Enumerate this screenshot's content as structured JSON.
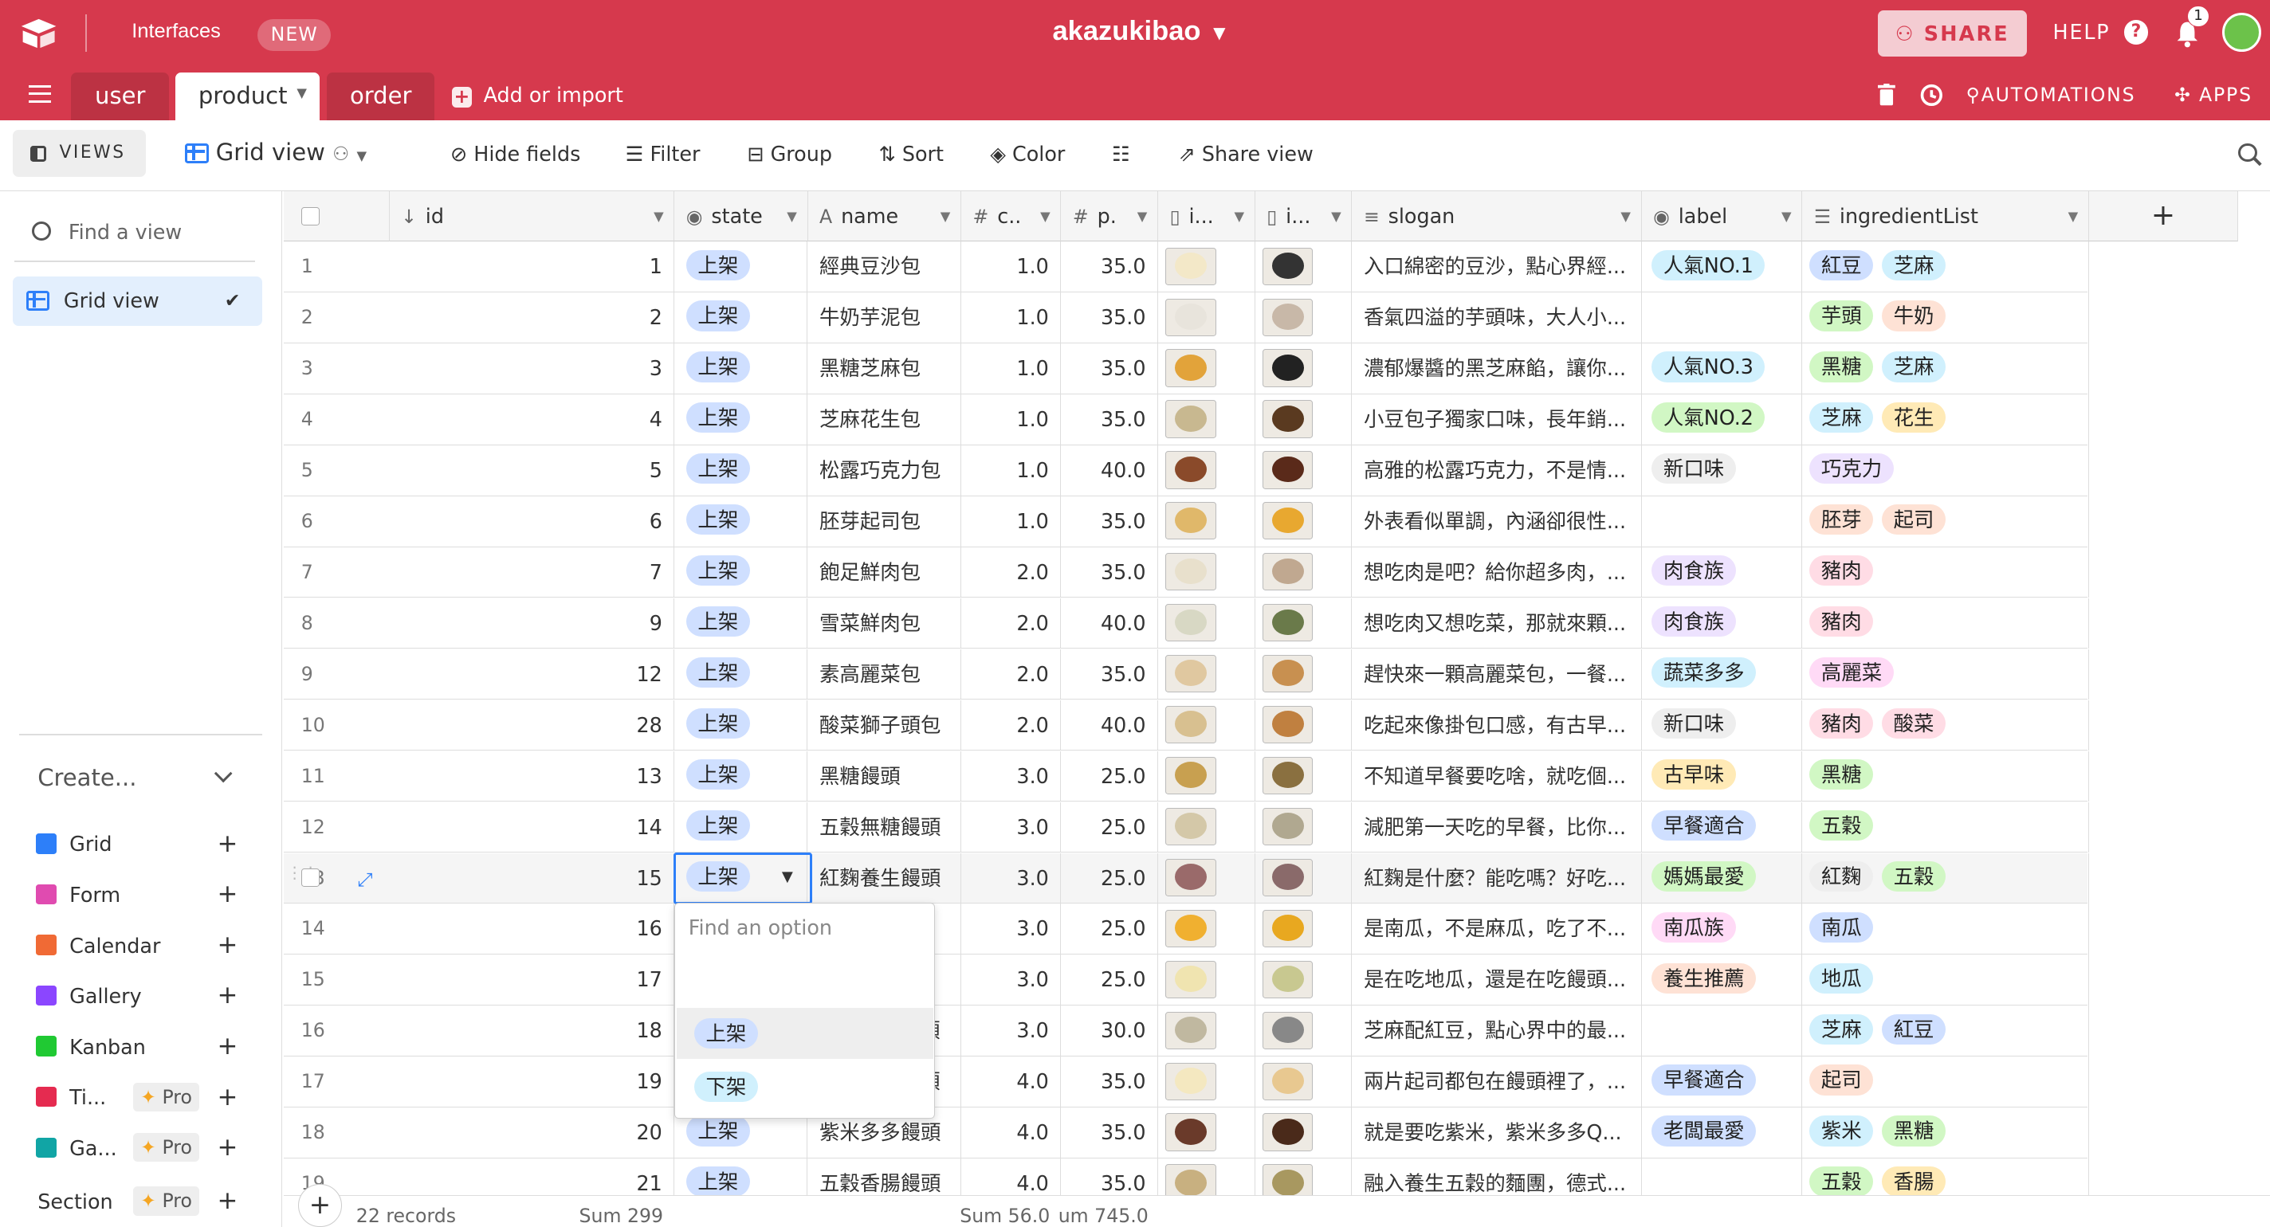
{
  "topbar": {
    "interfaces": "Interfaces",
    "new_badge": "NEW",
    "base_name": "akazukibao",
    "share": "SHARE",
    "help": "HELP",
    "notifications": "1",
    "accent": "#d6394d"
  },
  "tabs": [
    {
      "label": "user"
    },
    {
      "label": "product",
      "active": true
    },
    {
      "label": "order"
    }
  ],
  "add_import": "Add or import",
  "toolbar_right": {
    "automations": "AUTOMATIONS",
    "apps": "APPS"
  },
  "viewbar": {
    "views": "VIEWS",
    "view_name": "Grid view",
    "hide_fields": "Hide fields",
    "filter": "Filter",
    "group": "Group",
    "sort": "Sort",
    "color": "Color",
    "share_view": "Share view"
  },
  "sidebar": {
    "find_view": "Find a view",
    "current_view": "Grid view",
    "create": "Create...",
    "items": [
      {
        "label": "Grid",
        "color": "#2d7ff9"
      },
      {
        "label": "Form",
        "color": "#e04bb0"
      },
      {
        "label": "Calendar",
        "color": "#f06a35"
      },
      {
        "label": "Gallery",
        "color": "#8b46ff"
      },
      {
        "label": "Kanban",
        "color": "#20c933"
      },
      {
        "label": "Ti...",
        "color": "#e52b50",
        "pro": "Pro"
      },
      {
        "label": "Ga...",
        "color": "#11a5a5",
        "pro": "Pro"
      },
      {
        "label": "Section",
        "pro": "Pro"
      }
    ]
  },
  "columns": [
    "id",
    "state",
    "name",
    "c..",
    "p.",
    "i...",
    "i...",
    "slogan",
    "label",
    "ingredientList"
  ],
  "rows": [
    {
      "n": "1",
      "id": "1",
      "state": "上架",
      "name": "經典豆沙包",
      "c": "1.0",
      "p": "35.0",
      "slogan": "入口綿密的豆沙，點心界經...",
      "label": "人氣NO.1",
      "ing": [
        "紅豆",
        "芝麻"
      ]
    },
    {
      "n": "2",
      "id": "2",
      "state": "上架",
      "name": "牛奶芋泥包",
      "c": "1.0",
      "p": "35.0",
      "slogan": "香氣四溢的芋頭味，大人小...",
      "label": "",
      "ing": [
        "芋頭",
        "牛奶"
      ]
    },
    {
      "n": "3",
      "id": "3",
      "state": "上架",
      "name": "黑糖芝麻包",
      "c": "1.0",
      "p": "35.0",
      "slogan": "濃郁爆醬的黑芝麻餡，讓你...",
      "label": "人氣NO.3",
      "ing": [
        "黑糖",
        "芝麻"
      ]
    },
    {
      "n": "4",
      "id": "4",
      "state": "上架",
      "name": "芝麻花生包",
      "c": "1.0",
      "p": "35.0",
      "slogan": "小豆包子獨家口味，長年銷...",
      "label": "人氣NO.2",
      "ing": [
        "芝麻",
        "花生"
      ]
    },
    {
      "n": "5",
      "id": "5",
      "state": "上架",
      "name": "松露巧克力包",
      "c": "1.0",
      "p": "40.0",
      "slogan": "高雅的松露巧克力，不是情...",
      "label": "新口味",
      "ing": [
        "巧克力"
      ]
    },
    {
      "n": "6",
      "id": "6",
      "state": "上架",
      "name": "胚芽起司包",
      "c": "1.0",
      "p": "35.0",
      "slogan": "外表看似單調，內涵卻很性...",
      "label": "",
      "ing": [
        "胚芽",
        "起司"
      ]
    },
    {
      "n": "7",
      "id": "7",
      "state": "上架",
      "name": "飽足鮮肉包",
      "c": "2.0",
      "p": "35.0",
      "slogan": "想吃肉是吧？給你超多肉，...",
      "label": "肉食族",
      "ing": [
        "豬肉"
      ]
    },
    {
      "n": "8",
      "id": "9",
      "state": "上架",
      "name": "雪菜鮮肉包",
      "c": "2.0",
      "p": "40.0",
      "slogan": "想吃肉又想吃菜，那就來顆...",
      "label": "肉食族",
      "ing": [
        "豬肉"
      ]
    },
    {
      "n": "9",
      "id": "12",
      "state": "上架",
      "name": "素高麗菜包",
      "c": "2.0",
      "p": "35.0",
      "slogan": "趕快來一顆高麗菜包，一餐...",
      "label": "蔬菜多多",
      "ing": [
        "高麗菜"
      ]
    },
    {
      "n": "10",
      "id": "28",
      "state": "上架",
      "name": "酸菜獅子頭包",
      "c": "2.0",
      "p": "40.0",
      "slogan": "吃起來像掛包口感，有古早...",
      "label": "新口味",
      "ing": [
        "豬肉",
        "酸菜"
      ]
    },
    {
      "n": "11",
      "id": "13",
      "state": "上架",
      "name": "黑糖饅頭",
      "c": "3.0",
      "p": "25.0",
      "slogan": "不知道早餐要吃啥，就吃個...",
      "label": "古早味",
      "ing": [
        "黑糖"
      ]
    },
    {
      "n": "12",
      "id": "14",
      "state": "上架",
      "name": "五穀無糖饅頭",
      "c": "3.0",
      "p": "25.0",
      "slogan": "減肥第一天吃的早餐，比你...",
      "label": "早餐適合",
      "ing": [
        "五穀"
      ]
    },
    {
      "n": "13",
      "id": "15",
      "state": "上架",
      "name": "紅麴養生饅頭",
      "c": "3.0",
      "p": "25.0",
      "slogan": "紅麴是什麼？能吃嗎？好吃...",
      "label": "媽媽最愛",
      "ing": [
        "紅麴",
        "五穀"
      ]
    },
    {
      "n": "14",
      "id": "16",
      "state": "",
      "name": "",
      "c": "3.0",
      "p": "25.0",
      "slogan": "是南瓜，不是麻瓜，吃了不...",
      "label": "南瓜族",
      "ing": [
        "南瓜"
      ]
    },
    {
      "n": "15",
      "id": "17",
      "state": "",
      "name": "",
      "c": "3.0",
      "p": "25.0",
      "slogan": "是在吃地瓜，還是在吃饅頭...",
      "label": "養生推薦",
      "ing": [
        "地瓜"
      ]
    },
    {
      "n": "16",
      "id": "18",
      "state": "",
      "name": "頭",
      "c": "3.0",
      "p": "30.0",
      "slogan": "芝麻配紅豆，點心界中的最...",
      "label": "",
      "ing": [
        "芝麻",
        "紅豆"
      ]
    },
    {
      "n": "17",
      "id": "19",
      "state": "",
      "name": "頭",
      "c": "4.0",
      "p": "35.0",
      "slogan": "兩片起司都包在饅頭裡了，...",
      "label": "早餐適合",
      "ing": [
        "起司"
      ]
    },
    {
      "n": "18",
      "id": "20",
      "state": "上架",
      "name": "紫米多多饅頭",
      "c": "4.0",
      "p": "35.0",
      "slogan": "就是要吃紫米，紫米多多Q...",
      "label": "老闆最愛",
      "ing": [
        "紫米",
        "黑糖"
      ]
    },
    {
      "n": "19",
      "id": "21",
      "state": "上架",
      "name": "五穀香腸饅頭",
      "c": "4.0",
      "p": "35.0",
      "slogan": "融入養生五穀的麵團，德式...",
      "label": "",
      "ing": [
        "五穀",
        "香腸"
      ]
    }
  ],
  "dropdown": {
    "search_placeholder": "Find an option",
    "options": [
      "上架",
      "下架"
    ]
  },
  "footer": {
    "records": "22 records",
    "sum_id": "Sum 299",
    "sum_c": "Sum 56.0",
    "sum_p": "um 745.0"
  }
}
